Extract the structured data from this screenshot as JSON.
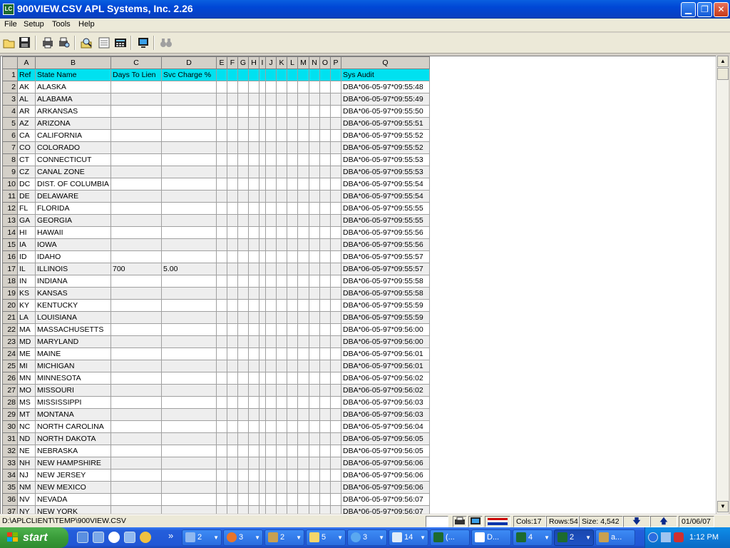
{
  "window": {
    "title": "900VIEW.CSV  APL Systems, Inc. 2.26",
    "icon_text": "LC",
    "minimize_glyph": "▁",
    "restore_glyph": "❐",
    "close_glyph": "✕"
  },
  "menu": [
    "File",
    "Setup",
    "Tools",
    "Help"
  ],
  "toolbar_icons": [
    "open-folder-icon",
    "save-icon",
    "print-icon",
    "print-preview-icon",
    "find-icon",
    "form-view-icon",
    "calculator-icon",
    "screen-icon",
    "binoculars-icon"
  ],
  "sheet": {
    "columns": [
      "A",
      "B",
      "C",
      "D",
      "E",
      "F",
      "G",
      "H",
      "I",
      "J",
      "K",
      "L",
      "M",
      "N",
      "O",
      "P",
      "Q"
    ],
    "header_row": {
      "num": "1",
      "cells": [
        "Ref",
        "State Name",
        "Days To Lien",
        "Svc Charge %",
        "",
        "",
        "",
        "",
        "",
        "",
        "",
        "",
        "",
        "",
        "",
        "",
        "Sys Audit"
      ]
    },
    "rows": [
      {
        "num": "2",
        "ref": "AK",
        "name": "ALASKA",
        "days": "",
        "svc": "",
        "audit": "DBA*06-05-97*09:55:48"
      },
      {
        "num": "3",
        "ref": "AL",
        "name": "ALABAMA",
        "days": "",
        "svc": "",
        "audit": "DBA*06-05-97*09:55:49"
      },
      {
        "num": "4",
        "ref": "AR",
        "name": "ARKANSAS",
        "days": "",
        "svc": "",
        "audit": "DBA*06-05-97*09:55:50"
      },
      {
        "num": "5",
        "ref": "AZ",
        "name": "ARIZONA",
        "days": "",
        "svc": "",
        "audit": "DBA*06-05-97*09:55:51"
      },
      {
        "num": "6",
        "ref": "CA",
        "name": "CALIFORNIA",
        "days": "",
        "svc": "",
        "audit": "DBA*06-05-97*09:55:52"
      },
      {
        "num": "7",
        "ref": "CO",
        "name": "COLORADO",
        "days": "",
        "svc": "",
        "audit": "DBA*06-05-97*09:55:52"
      },
      {
        "num": "8",
        "ref": "CT",
        "name": "CONNECTICUT",
        "days": "",
        "svc": "",
        "audit": "DBA*06-05-97*09:55:53"
      },
      {
        "num": "9",
        "ref": "CZ",
        "name": "CANAL ZONE",
        "days": "",
        "svc": "",
        "audit": "DBA*06-05-97*09:55:53"
      },
      {
        "num": "10",
        "ref": "DC",
        "name": "DIST. OF COLUMBIA",
        "days": "",
        "svc": "",
        "audit": "DBA*06-05-97*09:55:54"
      },
      {
        "num": "11",
        "ref": "DE",
        "name": "DELAWARE",
        "days": "",
        "svc": "",
        "audit": "DBA*06-05-97*09:55:54"
      },
      {
        "num": "12",
        "ref": "FL",
        "name": "FLORIDA",
        "days": "",
        "svc": "",
        "audit": "DBA*06-05-97*09:55:55"
      },
      {
        "num": "13",
        "ref": "GA",
        "name": "GEORGIA",
        "days": "",
        "svc": "",
        "audit": "DBA*06-05-97*09:55:55"
      },
      {
        "num": "14",
        "ref": "HI",
        "name": "HAWAII",
        "days": "",
        "svc": "",
        "audit": "DBA*06-05-97*09:55:56"
      },
      {
        "num": "15",
        "ref": "IA",
        "name": "IOWA",
        "days": "",
        "svc": "",
        "audit": "DBA*06-05-97*09:55:56"
      },
      {
        "num": "16",
        "ref": "ID",
        "name": "IDAHO",
        "days": "",
        "svc": "",
        "audit": "DBA*06-05-97*09:55:57"
      },
      {
        "num": "17",
        "ref": "IL",
        "name": "ILLINOIS",
        "days": "700",
        "svc": "5.00",
        "audit": "DBA*06-05-97*09:55:57"
      },
      {
        "num": "18",
        "ref": "IN",
        "name": "INDIANA",
        "days": "",
        "svc": "",
        "audit": "DBA*06-05-97*09:55:58"
      },
      {
        "num": "19",
        "ref": "KS",
        "name": "KANSAS",
        "days": "",
        "svc": "",
        "audit": "DBA*06-05-97*09:55:58"
      },
      {
        "num": "20",
        "ref": "KY",
        "name": "KENTUCKY",
        "days": "",
        "svc": "",
        "audit": "DBA*06-05-97*09:55:59"
      },
      {
        "num": "21",
        "ref": "LA",
        "name": "LOUISIANA",
        "days": "",
        "svc": "",
        "audit": "DBA*06-05-97*09:55:59"
      },
      {
        "num": "22",
        "ref": "MA",
        "name": "MASSACHUSETTS",
        "days": "",
        "svc": "",
        "audit": "DBA*06-05-97*09:56:00"
      },
      {
        "num": "23",
        "ref": "MD",
        "name": "MARYLAND",
        "days": "",
        "svc": "",
        "audit": "DBA*06-05-97*09:56:00"
      },
      {
        "num": "24",
        "ref": "ME",
        "name": "MAINE",
        "days": "",
        "svc": "",
        "audit": "DBA*06-05-97*09:56:01"
      },
      {
        "num": "25",
        "ref": "MI",
        "name": "MICHIGAN",
        "days": "",
        "svc": "",
        "audit": "DBA*06-05-97*09:56:01"
      },
      {
        "num": "26",
        "ref": "MN",
        "name": "MINNESOTA",
        "days": "",
        "svc": "",
        "audit": "DBA*06-05-97*09:56:02"
      },
      {
        "num": "27",
        "ref": "MO",
        "name": "MISSOURI",
        "days": "",
        "svc": "",
        "audit": "DBA*06-05-97*09:56:02"
      },
      {
        "num": "28",
        "ref": "MS",
        "name": "MISSISSIPPI",
        "days": "",
        "svc": "",
        "audit": "DBA*06-05-97*09:56:03"
      },
      {
        "num": "29",
        "ref": "MT",
        "name": "MONTANA",
        "days": "",
        "svc": "",
        "audit": "DBA*06-05-97*09:56:03"
      },
      {
        "num": "30",
        "ref": "NC",
        "name": "NORTH CAROLINA",
        "days": "",
        "svc": "",
        "audit": "DBA*06-05-97*09:56:04"
      },
      {
        "num": "31",
        "ref": "ND",
        "name": "NORTH DAKOTA",
        "days": "",
        "svc": "",
        "audit": "DBA*06-05-97*09:56:05"
      },
      {
        "num": "32",
        "ref": "NE",
        "name": "NEBRASKA",
        "days": "",
        "svc": "",
        "audit": "DBA*06-05-97*09:56:05"
      },
      {
        "num": "33",
        "ref": "NH",
        "name": "NEW HAMPSHIRE",
        "days": "",
        "svc": "",
        "audit": "DBA*06-05-97*09:56:06"
      },
      {
        "num": "34",
        "ref": "NJ",
        "name": "NEW JERSEY",
        "days": "",
        "svc": "",
        "audit": "DBA*06-05-97*09:56:06"
      },
      {
        "num": "35",
        "ref": "NM",
        "name": "NEW MEXICO",
        "days": "",
        "svc": "",
        "audit": "DBA*06-05-97*09:56:06"
      },
      {
        "num": "36",
        "ref": "NV",
        "name": "NEVADA",
        "days": "",
        "svc": "",
        "audit": "DBA*06-05-97*09:56:07"
      },
      {
        "num": "37",
        "ref": "NY",
        "name": "NEW YORK",
        "days": "",
        "svc": "",
        "audit": "DBA*06-05-97*09:56:07"
      }
    ]
  },
  "scrollbar": {
    "up": "▲",
    "down": "▼"
  },
  "status": {
    "path": "D:\\APLCLIENT\\TEMP\\900VIEW.CSV",
    "cols": "Cols:17",
    "rows": "Rows:54",
    "size": "Size: 4,542",
    "down_arrow": "🡇",
    "up_arrow": "🡅",
    "date": "01/06/07"
  },
  "taskbar": {
    "start": "start",
    "chevron": "»",
    "tasks": [
      {
        "label": "2",
        "arrow": "▼"
      },
      {
        "label": "3",
        "arrow": "▼"
      },
      {
        "label": "2",
        "arrow": "▼"
      },
      {
        "label": "5",
        "arrow": "▼"
      },
      {
        "label": "3",
        "arrow": "▼"
      },
      {
        "label": "14",
        "arrow": "▼"
      },
      {
        "label": "(..."
      },
      {
        "label": "D..."
      },
      {
        "label": "4",
        "arrow": "▼"
      },
      {
        "label": "2",
        "arrow": "▼"
      },
      {
        "label": "a..."
      }
    ],
    "clock": "1:12 PM"
  },
  "colors": {
    "header_row": "#00e1f0",
    "title_blue": "#0047d6",
    "taskbar_blue": "#245edb",
    "start_green": "#3a9c3a"
  }
}
